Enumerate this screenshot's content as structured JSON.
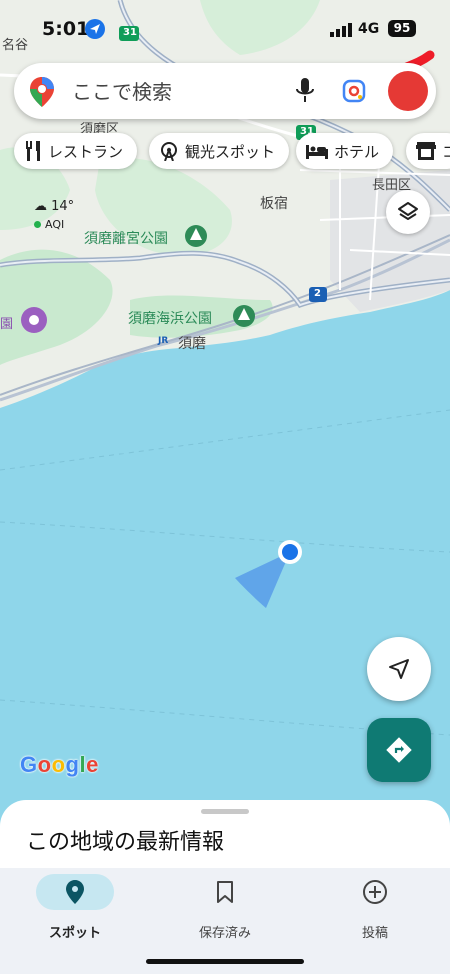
{
  "status": {
    "time": "5:01",
    "network": "4G",
    "battery": "95"
  },
  "search": {
    "placeholder": "ここで検索"
  },
  "chips": [
    {
      "label": "レストラン",
      "icon": "restaurant-icon"
    },
    {
      "label": "観光スポット",
      "icon": "ferris-wheel-icon"
    },
    {
      "label": "ホテル",
      "icon": "bed-icon"
    },
    {
      "label": "コ",
      "icon": "store-icon"
    }
  ],
  "weather": {
    "temp": "14°",
    "aqi": "AQI"
  },
  "map_labels": {
    "suma_ku": "須磨区",
    "itayado": "板宿",
    "nagata_ku": "長田区",
    "nago": "名谷",
    "suma": "須磨",
    "sono": "園",
    "route_31": "31",
    "route_31b": "31",
    "route_2": "2",
    "jr": "JR"
  },
  "parks": {
    "suma_rikyu": "須磨離宮公園",
    "suma_kaihin": "須磨海浜公園"
  },
  "logo": "Google",
  "sheet": {
    "title": "この地域の最新情報"
  },
  "bottom_nav": [
    {
      "label": "スポット",
      "icon": "location-pin-icon",
      "active": true
    },
    {
      "label": "保存済み",
      "icon": "bookmark-icon",
      "active": false
    },
    {
      "label": "投稿",
      "icon": "add-circle-icon",
      "active": false
    }
  ],
  "colors": {
    "sea": "#8fd6ea",
    "land": "#ecefe9",
    "park": "#c9e9cf",
    "accent": "#0f7a73",
    "blue": "#1a73e8"
  }
}
